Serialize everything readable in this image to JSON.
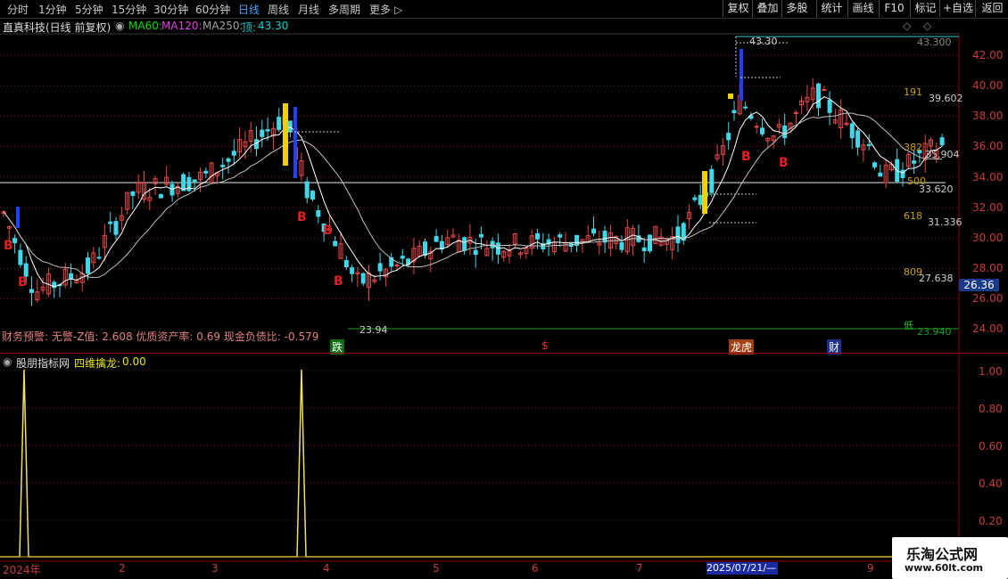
{
  "toolbar": {
    "periods": [
      "分时",
      "1分钟",
      "5分钟",
      "15分钟",
      "30分钟",
      "60分钟",
      "日线",
      "周线",
      "月线",
      "多周期",
      "更多"
    ],
    "active_period": "日线",
    "more_arrow": "▷",
    "buttons": [
      "复权",
      "叠加",
      "多股",
      "统计",
      "画线",
      "F10",
      "标记",
      "+自选",
      "返回"
    ]
  },
  "stock": {
    "title": "直真科技(日线 前复权)",
    "ma60_label": "MA60:",
    "ma120_label": "MA120:",
    "ma250_label": "MA250:",
    "top_label": "顶:",
    "top_value": "43.30",
    "ma_colors": {
      "ma60": "#00e000",
      "ma120": "#e040e0",
      "ma250": "#a0a0a0",
      "top": "#00d0d0"
    }
  },
  "main_axis": {
    "ticks": [
      "42.00",
      "40.00",
      "38.00",
      "36.00",
      "34.00",
      "32.00",
      "30.00",
      "28.00",
      "26.00",
      "24.00"
    ],
    "current_price": "26.36"
  },
  "price_levels": {
    "high_label": "43.30",
    "high_right": "43.300",
    "l191": "191",
    "l191_value": "39.602",
    "l382": "382",
    "l382_value": "35.904",
    "l500": "500",
    "l500_value": "33.620",
    "l618": "618",
    "l618_value": "31.336",
    "l809": "809",
    "l809_value": "27.638",
    "low_label": "低",
    "low_value": "23.940",
    "min_label": "23.94"
  },
  "signals": {
    "b": "B",
    "event_1": "跌",
    "event_2": "$",
    "event_3": "龙虎",
    "event_4": "财"
  },
  "finance": {
    "text": "财务预警: 无警-Z值: 2.608 优质资产率: 0.69 现金负债比: -0.579"
  },
  "sub_panel": {
    "name": "股朋指标网",
    "indicator": "四维擒龙:",
    "value": "0.00",
    "ticks": [
      "1.00",
      "0.80",
      "0.60",
      "0.40",
      "0.20"
    ]
  },
  "time_axis": {
    "labels": [
      "2024年",
      "2",
      "3",
      "4",
      "5",
      "6",
      "7",
      "9"
    ],
    "cursor_date": "2025/07/21/—"
  },
  "watermark": {
    "title": "乐淘公式网",
    "url": "www.60lt.com"
  }
}
